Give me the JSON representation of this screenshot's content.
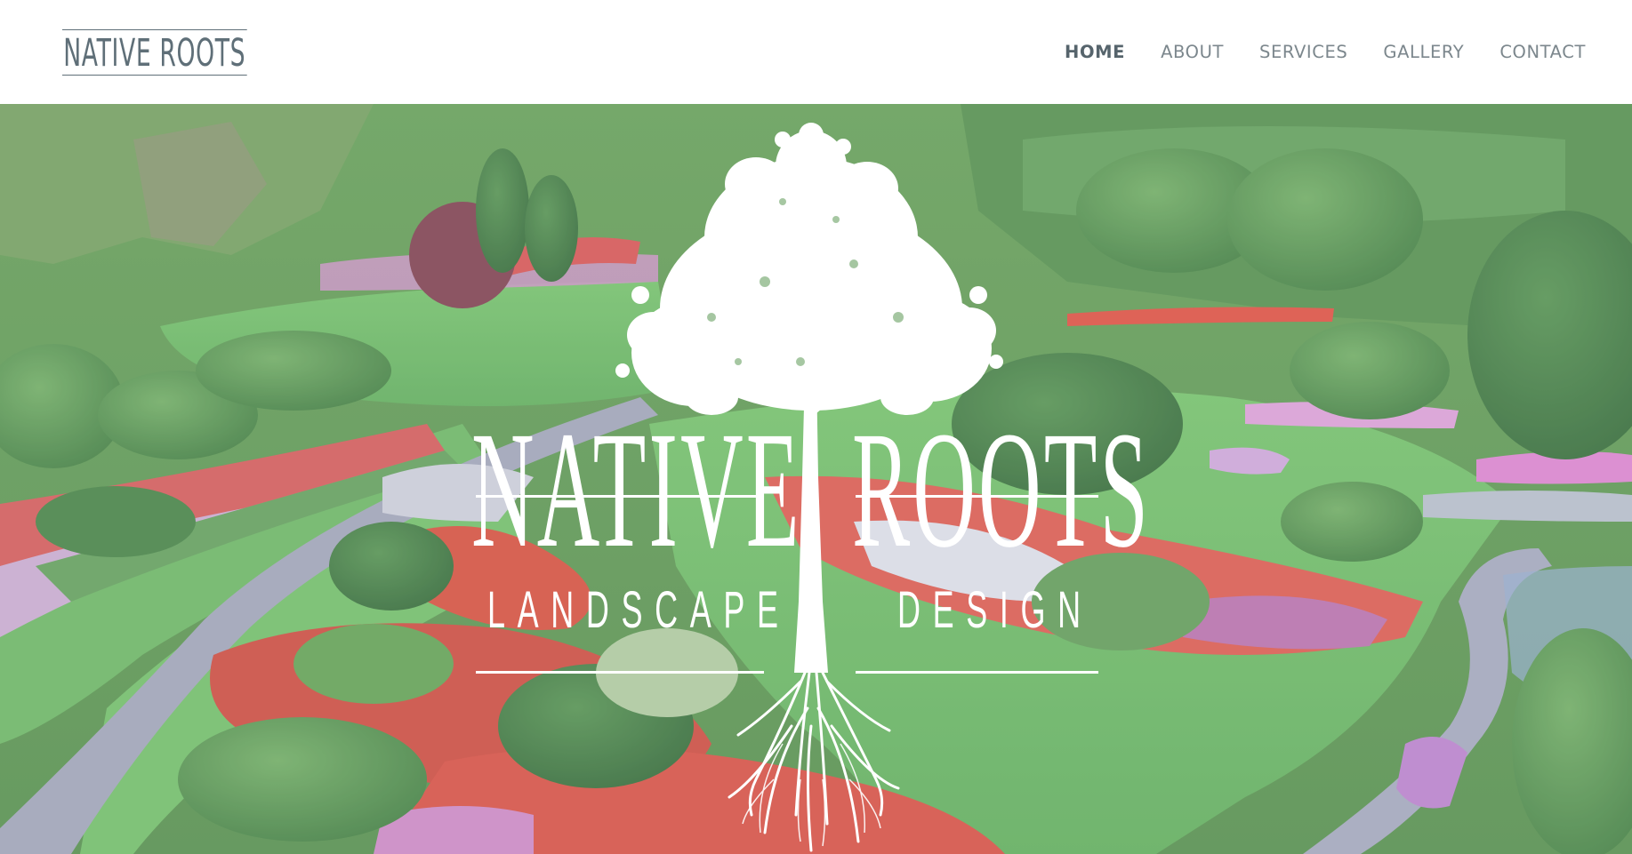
{
  "header": {
    "brand": "NATIVE ROOTS",
    "nav": [
      {
        "label": "HOME",
        "active": true
      },
      {
        "label": "ABOUT",
        "active": false
      },
      {
        "label": "SERVICES",
        "active": false
      },
      {
        "label": "GALLERY",
        "active": false
      },
      {
        "label": "CONTACT",
        "active": false
      }
    ]
  },
  "hero": {
    "title_left": "NATIVE",
    "title_right": "ROOTS",
    "subtitle_left": "LANDSCAPE",
    "subtitle_right": "DESIGN",
    "logo_icon": "tree-with-roots-icon",
    "background": "landscaped-garden-photo"
  },
  "colors": {
    "brand": "#5f6f78",
    "nav_text": "#7c878d",
    "nav_active": "#56646c",
    "logo_white": "#ffffff",
    "lawn": "#62b35f",
    "flower_red": "#d5483b",
    "flower_pink": "#c99ac8",
    "path": "#9a9fb4"
  }
}
